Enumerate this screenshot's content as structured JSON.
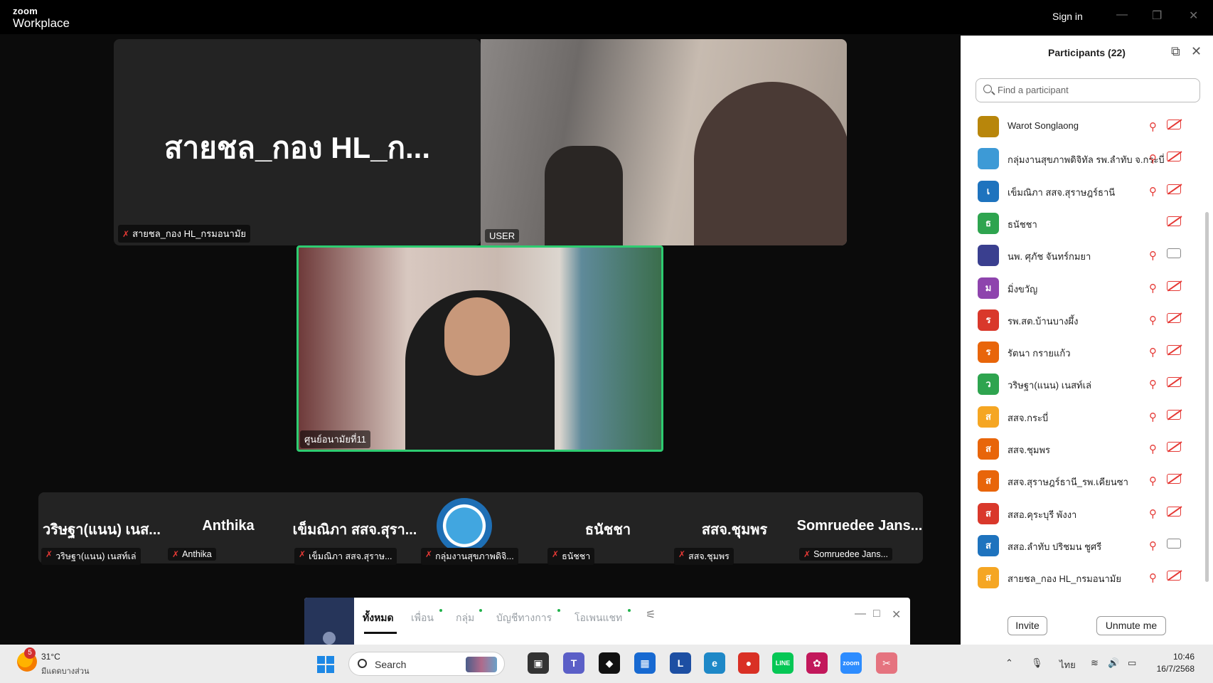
{
  "titlebar": {
    "logo_line1": "zoom",
    "logo_line2": "Workplace",
    "sign_in": "Sign in",
    "minimize": "—",
    "restore": "❐",
    "close": "✕"
  },
  "stage": {
    "top_left_tile": {
      "big_name": "สายชล_กอง HL_ก...",
      "label": "สายชล_กอง HL_กรมอนามัย"
    },
    "top_right_tile": {
      "label": "USER"
    },
    "active_tile": {
      "label": "ศูนย์อนามัยที่11"
    },
    "strip": [
      {
        "big_name": "วริษฐา(แนน) เนส...",
        "label": "วริษฐา(แนน) เนสท์เล่"
      },
      {
        "big_name": "Anthika",
        "label": "Anthika"
      },
      {
        "big_name": "เข็มณิภา สสจ.สุรา...",
        "label": "เข็มณิภา สสจ.สุราษ..."
      },
      {
        "big_name": "",
        "label": "กลุ่มงานสุขภาพดิจิ..."
      },
      {
        "big_name": "ธนัชชา",
        "label": "ธนัชชา"
      },
      {
        "big_name": "สสจ.ชุมพร",
        "label": "สสจ.ชุมพร"
      },
      {
        "big_name": "Somruedee Jans...",
        "label": "Somruedee Jans..."
      }
    ]
  },
  "chat": {
    "tabs": [
      "ทั้งหมด",
      "เพื่อน",
      "กลุ่ม",
      "บัญชีทางการ",
      "โอเพนแชท"
    ],
    "active_tab": "ทั้งหมด",
    "minimize": "—",
    "maximize": "□",
    "close": "✕"
  },
  "participants": {
    "title": "Participants (22)",
    "search_placeholder": "Find a participant",
    "list": [
      {
        "initial": "",
        "name": "Warot Songlaong",
        "color": "#b8860b",
        "mic": "off",
        "cam": "off"
      },
      {
        "initial": "",
        "name": "กลุ่มงานสุขภาพดิจิทัล รพ.ลำทับ จ.กระบี่",
        "color": "#3d9ad6",
        "mic": "off",
        "cam": "off"
      },
      {
        "initial": "เ",
        "name": "เข็มณิภา สสจ.สุราษฎร์ธานี",
        "color": "#1e73be",
        "mic": "off",
        "cam": "off"
      },
      {
        "initial": "ธ",
        "name": "ธนัชชา",
        "color": "#2ea44f",
        "mic": "none",
        "cam": "off"
      },
      {
        "initial": "",
        "name": "นพ. ศุภัช จันทร์กมยา",
        "color": "#3a3f8f",
        "mic": "off",
        "cam": "on"
      },
      {
        "initial": "ม",
        "name": "มิ่งขวัญ",
        "color": "#8e44ad",
        "mic": "off",
        "cam": "off"
      },
      {
        "initial": "ร",
        "name": "รพ.สต.บ้านบางผึ้ง",
        "color": "#d9382b",
        "mic": "off",
        "cam": "off"
      },
      {
        "initial": "ร",
        "name": "รัตนา กรายแก้ว",
        "color": "#e8650a",
        "mic": "off",
        "cam": "off"
      },
      {
        "initial": "ว",
        "name": "วริษฐา(แนน) เนสท์เล่",
        "color": "#2ea44f",
        "mic": "off",
        "cam": "off"
      },
      {
        "initial": "ส",
        "name": "สสจ.กระบี่",
        "color": "#f5a623",
        "mic": "off",
        "cam": "off"
      },
      {
        "initial": "ส",
        "name": "สสจ.ชุมพร",
        "color": "#e8650a",
        "mic": "off",
        "cam": "off"
      },
      {
        "initial": "ส",
        "name": "สสจ.สุราษฎร์ธานี_รพ.เคียนซา",
        "color": "#e8650a",
        "mic": "off",
        "cam": "off"
      },
      {
        "initial": "ส",
        "name": "สสอ.คุระบุรี พังงา",
        "color": "#d9382b",
        "mic": "off",
        "cam": "off"
      },
      {
        "initial": "ส",
        "name": "สสอ.ลำทับ ปริชมน ชูศรี",
        "color": "#1e73be",
        "mic": "off",
        "cam": "on"
      },
      {
        "initial": "ส",
        "name": "สายชล_กอง HL_กรมอนามัย",
        "color": "#f5a623",
        "mic": "off",
        "cam": "off"
      }
    ],
    "invite": "Invite",
    "unmute_me": "Unmute me"
  },
  "taskbar": {
    "weather_badge": "5",
    "weather_temp": "31°C",
    "weather_desc": "มีแดดบางส่วน",
    "search_label": "Search",
    "apps": [
      {
        "name": "task-view",
        "glyph": "▣",
        "color": "#333"
      },
      {
        "name": "teams",
        "glyph": "T",
        "color": "#5b5fc7"
      },
      {
        "name": "dropbox",
        "glyph": "◆",
        "color": "#111"
      },
      {
        "name": "store",
        "glyph": "▦",
        "color": "#1769d1"
      },
      {
        "name": "l-app",
        "glyph": "L",
        "color": "#1d4fa3"
      },
      {
        "name": "edge",
        "glyph": "e",
        "color": "#1e88c7"
      },
      {
        "name": "chrome",
        "glyph": "●",
        "color": "#d93025"
      },
      {
        "name": "line",
        "glyph": "LINE",
        "color": "#06c755"
      },
      {
        "name": "photos",
        "glyph": "✿",
        "color": "#c2185b"
      },
      {
        "name": "zoom",
        "glyph": "zoom",
        "color": "#2d8cff"
      },
      {
        "name": "snipping",
        "glyph": "✂",
        "color": "#e5737f"
      }
    ],
    "lang": "ไทย",
    "time": "10:46",
    "date": "16/7/2568"
  }
}
